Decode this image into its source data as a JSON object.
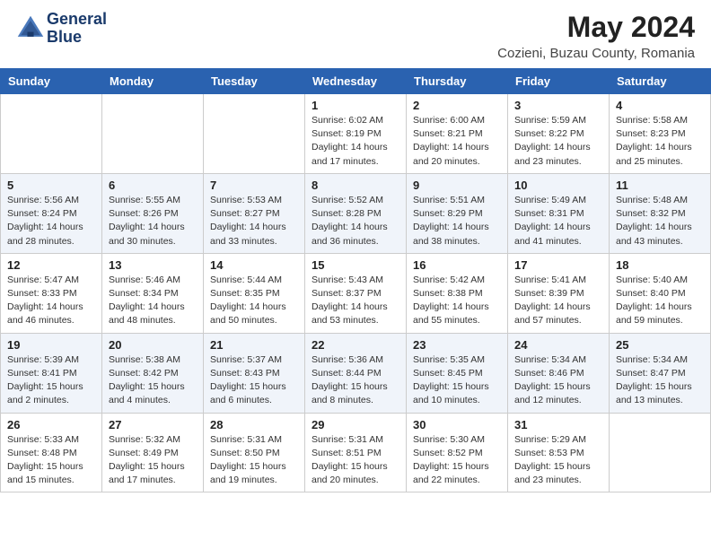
{
  "header": {
    "logo_line1": "General",
    "logo_line2": "Blue",
    "month": "May 2024",
    "location": "Cozieni, Buzau County, Romania"
  },
  "days_of_week": [
    "Sunday",
    "Monday",
    "Tuesday",
    "Wednesday",
    "Thursday",
    "Friday",
    "Saturday"
  ],
  "weeks": [
    [
      {
        "day": "",
        "info": ""
      },
      {
        "day": "",
        "info": ""
      },
      {
        "day": "",
        "info": ""
      },
      {
        "day": "1",
        "info": "Sunrise: 6:02 AM\nSunset: 8:19 PM\nDaylight: 14 hours\nand 17 minutes."
      },
      {
        "day": "2",
        "info": "Sunrise: 6:00 AM\nSunset: 8:21 PM\nDaylight: 14 hours\nand 20 minutes."
      },
      {
        "day": "3",
        "info": "Sunrise: 5:59 AM\nSunset: 8:22 PM\nDaylight: 14 hours\nand 23 minutes."
      },
      {
        "day": "4",
        "info": "Sunrise: 5:58 AM\nSunset: 8:23 PM\nDaylight: 14 hours\nand 25 minutes."
      }
    ],
    [
      {
        "day": "5",
        "info": "Sunrise: 5:56 AM\nSunset: 8:24 PM\nDaylight: 14 hours\nand 28 minutes."
      },
      {
        "day": "6",
        "info": "Sunrise: 5:55 AM\nSunset: 8:26 PM\nDaylight: 14 hours\nand 30 minutes."
      },
      {
        "day": "7",
        "info": "Sunrise: 5:53 AM\nSunset: 8:27 PM\nDaylight: 14 hours\nand 33 minutes."
      },
      {
        "day": "8",
        "info": "Sunrise: 5:52 AM\nSunset: 8:28 PM\nDaylight: 14 hours\nand 36 minutes."
      },
      {
        "day": "9",
        "info": "Sunrise: 5:51 AM\nSunset: 8:29 PM\nDaylight: 14 hours\nand 38 minutes."
      },
      {
        "day": "10",
        "info": "Sunrise: 5:49 AM\nSunset: 8:31 PM\nDaylight: 14 hours\nand 41 minutes."
      },
      {
        "day": "11",
        "info": "Sunrise: 5:48 AM\nSunset: 8:32 PM\nDaylight: 14 hours\nand 43 minutes."
      }
    ],
    [
      {
        "day": "12",
        "info": "Sunrise: 5:47 AM\nSunset: 8:33 PM\nDaylight: 14 hours\nand 46 minutes."
      },
      {
        "day": "13",
        "info": "Sunrise: 5:46 AM\nSunset: 8:34 PM\nDaylight: 14 hours\nand 48 minutes."
      },
      {
        "day": "14",
        "info": "Sunrise: 5:44 AM\nSunset: 8:35 PM\nDaylight: 14 hours\nand 50 minutes."
      },
      {
        "day": "15",
        "info": "Sunrise: 5:43 AM\nSunset: 8:37 PM\nDaylight: 14 hours\nand 53 minutes."
      },
      {
        "day": "16",
        "info": "Sunrise: 5:42 AM\nSunset: 8:38 PM\nDaylight: 14 hours\nand 55 minutes."
      },
      {
        "day": "17",
        "info": "Sunrise: 5:41 AM\nSunset: 8:39 PM\nDaylight: 14 hours\nand 57 minutes."
      },
      {
        "day": "18",
        "info": "Sunrise: 5:40 AM\nSunset: 8:40 PM\nDaylight: 14 hours\nand 59 minutes."
      }
    ],
    [
      {
        "day": "19",
        "info": "Sunrise: 5:39 AM\nSunset: 8:41 PM\nDaylight: 15 hours\nand 2 minutes."
      },
      {
        "day": "20",
        "info": "Sunrise: 5:38 AM\nSunset: 8:42 PM\nDaylight: 15 hours\nand 4 minutes."
      },
      {
        "day": "21",
        "info": "Sunrise: 5:37 AM\nSunset: 8:43 PM\nDaylight: 15 hours\nand 6 minutes."
      },
      {
        "day": "22",
        "info": "Sunrise: 5:36 AM\nSunset: 8:44 PM\nDaylight: 15 hours\nand 8 minutes."
      },
      {
        "day": "23",
        "info": "Sunrise: 5:35 AM\nSunset: 8:45 PM\nDaylight: 15 hours\nand 10 minutes."
      },
      {
        "day": "24",
        "info": "Sunrise: 5:34 AM\nSunset: 8:46 PM\nDaylight: 15 hours\nand 12 minutes."
      },
      {
        "day": "25",
        "info": "Sunrise: 5:34 AM\nSunset: 8:47 PM\nDaylight: 15 hours\nand 13 minutes."
      }
    ],
    [
      {
        "day": "26",
        "info": "Sunrise: 5:33 AM\nSunset: 8:48 PM\nDaylight: 15 hours\nand 15 minutes."
      },
      {
        "day": "27",
        "info": "Sunrise: 5:32 AM\nSunset: 8:49 PM\nDaylight: 15 hours\nand 17 minutes."
      },
      {
        "day": "28",
        "info": "Sunrise: 5:31 AM\nSunset: 8:50 PM\nDaylight: 15 hours\nand 19 minutes."
      },
      {
        "day": "29",
        "info": "Sunrise: 5:31 AM\nSunset: 8:51 PM\nDaylight: 15 hours\nand 20 minutes."
      },
      {
        "day": "30",
        "info": "Sunrise: 5:30 AM\nSunset: 8:52 PM\nDaylight: 15 hours\nand 22 minutes."
      },
      {
        "day": "31",
        "info": "Sunrise: 5:29 AM\nSunset: 8:53 PM\nDaylight: 15 hours\nand 23 minutes."
      },
      {
        "day": "",
        "info": ""
      }
    ]
  ]
}
